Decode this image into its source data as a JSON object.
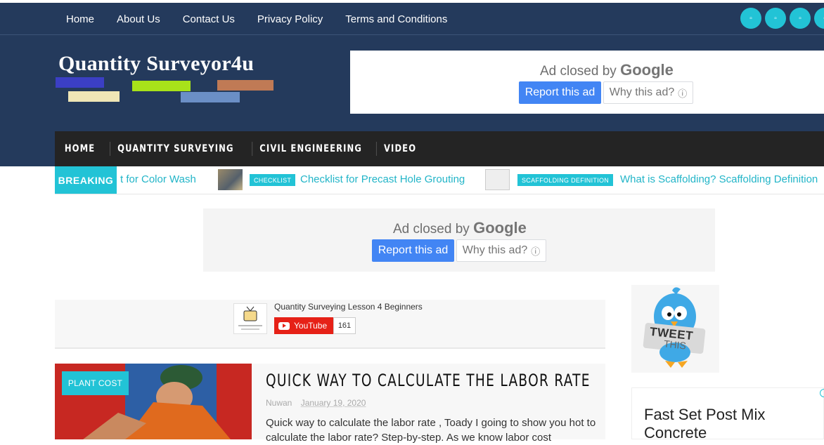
{
  "top_nav": {
    "items": [
      "Home",
      "About Us",
      "Contact Us",
      "Privacy Policy",
      "Terms and Conditions"
    ]
  },
  "socials": [
    {
      "icon": "facebook-icon"
    },
    {
      "icon": "twitter-icon"
    },
    {
      "icon": "pinterest-icon"
    },
    {
      "icon": "youtube-icon"
    }
  ],
  "logo": {
    "text": "Quantity Surveyor4u",
    "bar_colors": [
      "#3b3fc4",
      "#a8e21a",
      "#c07a55",
      "#efe6b6",
      "#6b8fc6"
    ]
  },
  "ad_top": {
    "closed_prefix": "Ad closed by",
    "brand": "Google",
    "report_label": "Report this ad",
    "why_label": "Why this ad?",
    "why_icon": "info-icon"
  },
  "main_nav": {
    "items": [
      "HOME",
      "QUANTITY SURVEYING",
      "CIVIL ENGINEERING",
      "VIDEO"
    ]
  },
  "breaking": {
    "label": "BREAKING",
    "partial_text": "t for Color Wash",
    "items": [
      {
        "tag": "CHECKLIST",
        "text": "Checklist for Precast Hole Grouting"
      },
      {
        "tag": "SCAFFOLDING DEFINITION",
        "text": "What is Scaffolding? Scaffolding Definition"
      }
    ]
  },
  "ad_mid": {
    "closed_prefix": "Ad closed by",
    "brand": "Google",
    "report_label": "Report this ad",
    "why_label": "Why this ad?",
    "why_icon": "info-icon"
  },
  "youtube": {
    "channel_title": "Quantity Surveying Lesson 4 Beginners",
    "button_label": "YouTube",
    "subscriber_count": "161"
  },
  "post": {
    "category": "PLANT COST",
    "title": "QUICK WAY TO CALCULATE THE LABOR RATE",
    "author": "Nuwan",
    "date": "January 19, 2020",
    "excerpt": "Quick way to calculate the labor rate , Toady I going to show you hot to calculate the labor rate? Step-by-step. As we know labor cost"
  },
  "sidebar": {
    "tweet_widget": {
      "line1": "TWEET",
      "line2": "THIS"
    },
    "card_title": "Fast Set Post Mix Concrete"
  },
  "colors": {
    "header_bg": "#243a5c",
    "accent": "#22c3d6",
    "nav_bg": "#242424",
    "google_blue": "#4285f4"
  }
}
